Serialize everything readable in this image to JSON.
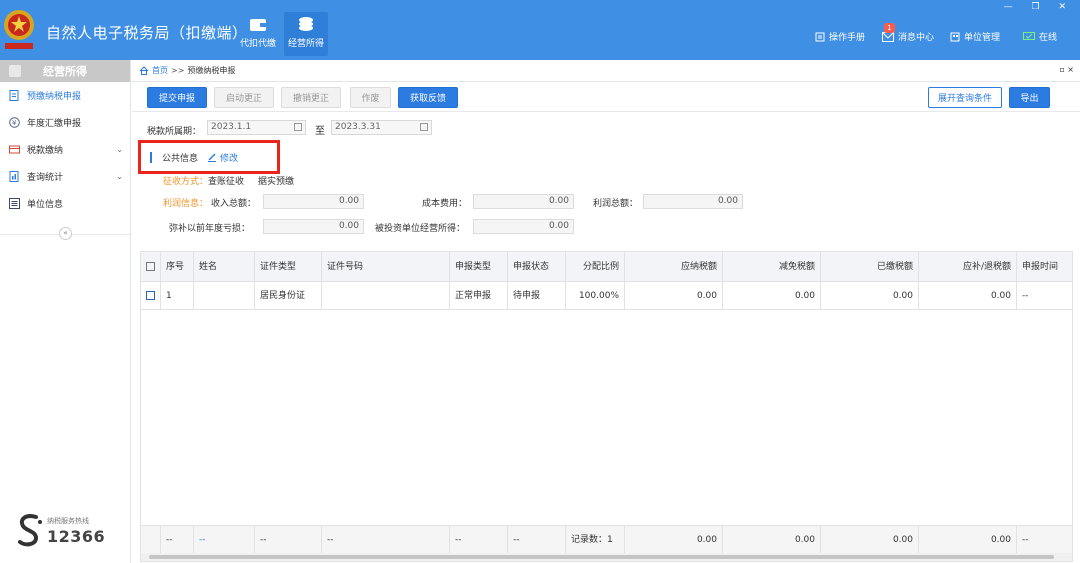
{
  "app": {
    "title": "自然人电子税务局（扣缴端）",
    "window_controls": "— ❐ ✕"
  },
  "top_tabs": [
    {
      "label": "代扣代缴",
      "icon": "wallet-icon",
      "active": false
    },
    {
      "label": "经营所得",
      "icon": "coins-icon",
      "active": true
    }
  ],
  "top_right": {
    "manual": "操作手册",
    "messages": "消息中心",
    "message_count": "1",
    "unit_management": "单位管理",
    "online": "在线"
  },
  "sidebar": {
    "header": "经营所得",
    "items": [
      {
        "label": "预缴纳税申报",
        "icon": "declare-icon",
        "active": true,
        "has_children": false
      },
      {
        "label": "年度汇缴申报",
        "icon": "yuan-icon",
        "active": false,
        "has_children": false
      },
      {
        "label": "税款缴纳",
        "icon": "payment-icon",
        "active": false,
        "has_children": true
      },
      {
        "label": "查询统计",
        "icon": "report-icon",
        "active": false,
        "has_children": true
      },
      {
        "label": "单位信息",
        "icon": "list-icon",
        "active": false,
        "has_children": false
      }
    ],
    "collapse_symbol": "«",
    "hotline_label": "纳税服务热线",
    "hotline_number": "12366"
  },
  "breadcrumb": {
    "home": "首页",
    "separator": ">>",
    "current": "预缴纳税申报",
    "controls": "▫ ×"
  },
  "toolbar": {
    "submit": "提交申报",
    "start_correction": "启动更正",
    "cancel_correction": "撤销更正",
    "void": "作废",
    "get_feedback": "获取反馈",
    "expand_query": "展开查询条件",
    "export": "导出"
  },
  "period": {
    "label": "税款所属期：",
    "start": "2023.1.1",
    "to": "至",
    "end": "2023.3.31"
  },
  "public_info": {
    "title": "公共信息",
    "edit": "修改"
  },
  "collection": {
    "label": "征收方式：",
    "option1": "查账征收",
    "option2": "据实预缴"
  },
  "profit_info": {
    "section_label": "利润信息：",
    "income_label": "收入总额：",
    "income_value": "0.00",
    "cost_label": "成本费用：",
    "cost_value": "0.00",
    "profit_label": "利润总额：",
    "profit_value": "0.00",
    "loss_label": "弥补以前年度亏损：",
    "loss_value": "0.00",
    "invest_label": "被投资单位经营所得：",
    "invest_value": "0.00"
  },
  "table": {
    "headers": [
      "序号",
      "姓名",
      "证件类型",
      "证件号码",
      "申报类型",
      "申报状态",
      "分配比例",
      "应纳税额",
      "减免税额",
      "已缴税额",
      "应补/退税额",
      "申报时间"
    ],
    "rows": [
      {
        "no": "1",
        "name": "",
        "id_type": "居民身份证",
        "id_number": "",
        "declare_type": "正常申报",
        "status": "待申报",
        "ratio": "100.00%",
        "tax_payable": "0.00",
        "tax_relief": "0.00",
        "tax_paid": "0.00",
        "tax_diff": "0.00",
        "time": "--"
      }
    ],
    "footer": {
      "c1": "--",
      "c2": "--",
      "c3": "--",
      "c4": "--",
      "c5": "--",
      "c6": "--",
      "record_count": "记录数：1",
      "tax_payable": "0.00",
      "tax_relief": "0.00",
      "tax_paid": "0.00",
      "tax_diff": "0.00",
      "time": "--"
    }
  },
  "colors": {
    "titlebar": "#3f8fe4",
    "primary": "#2b7be0",
    "highlight": "#e8261c",
    "orange": "#f0932b"
  }
}
